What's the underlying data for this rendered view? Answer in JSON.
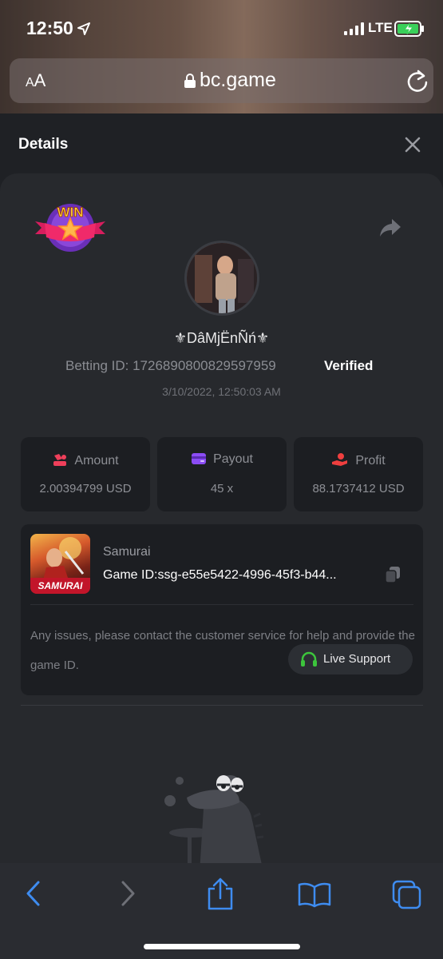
{
  "status_bar": {
    "time": "12:50",
    "network": "LTE"
  },
  "browser": {
    "text_size_label_small": "A",
    "text_size_label_large": "A",
    "url": "bc.game"
  },
  "header": {
    "title": "Details"
  },
  "bet": {
    "badge": "WIN",
    "username": "⚜DâMjËnÑń⚜",
    "betting_id_label": "Betting ID: 1726890800829597959",
    "verified_label": "Verified",
    "datetime": "3/10/2022, 12:50:03 AM"
  },
  "stats": [
    {
      "label": "Amount",
      "value": "2.00394799 USD",
      "icon": "coins-icon",
      "color": "#ef3f5a"
    },
    {
      "label": "Payout",
      "value": "45 x",
      "icon": "wallet-icon",
      "color": "#8b4cf5"
    },
    {
      "label": "Profit",
      "value": "88.1737412 USD",
      "icon": "hand-coin-icon",
      "color": "#ef3f3f"
    }
  ],
  "game": {
    "name": "Samurai",
    "thumb_label": "SAMURAI",
    "game_id": "Game ID:ssg-e55e5422-4996-45f3-b44...",
    "help_text": "Any issues, please contact the customer service for help and provide the game ID.",
    "live_support_label": "Live Support"
  },
  "colors": {
    "background": "#1f2125",
    "card": "#27292d",
    "panel": "#1c1e22",
    "accent_blue": "#3e8cf0",
    "support_green": "#3cc43c"
  }
}
